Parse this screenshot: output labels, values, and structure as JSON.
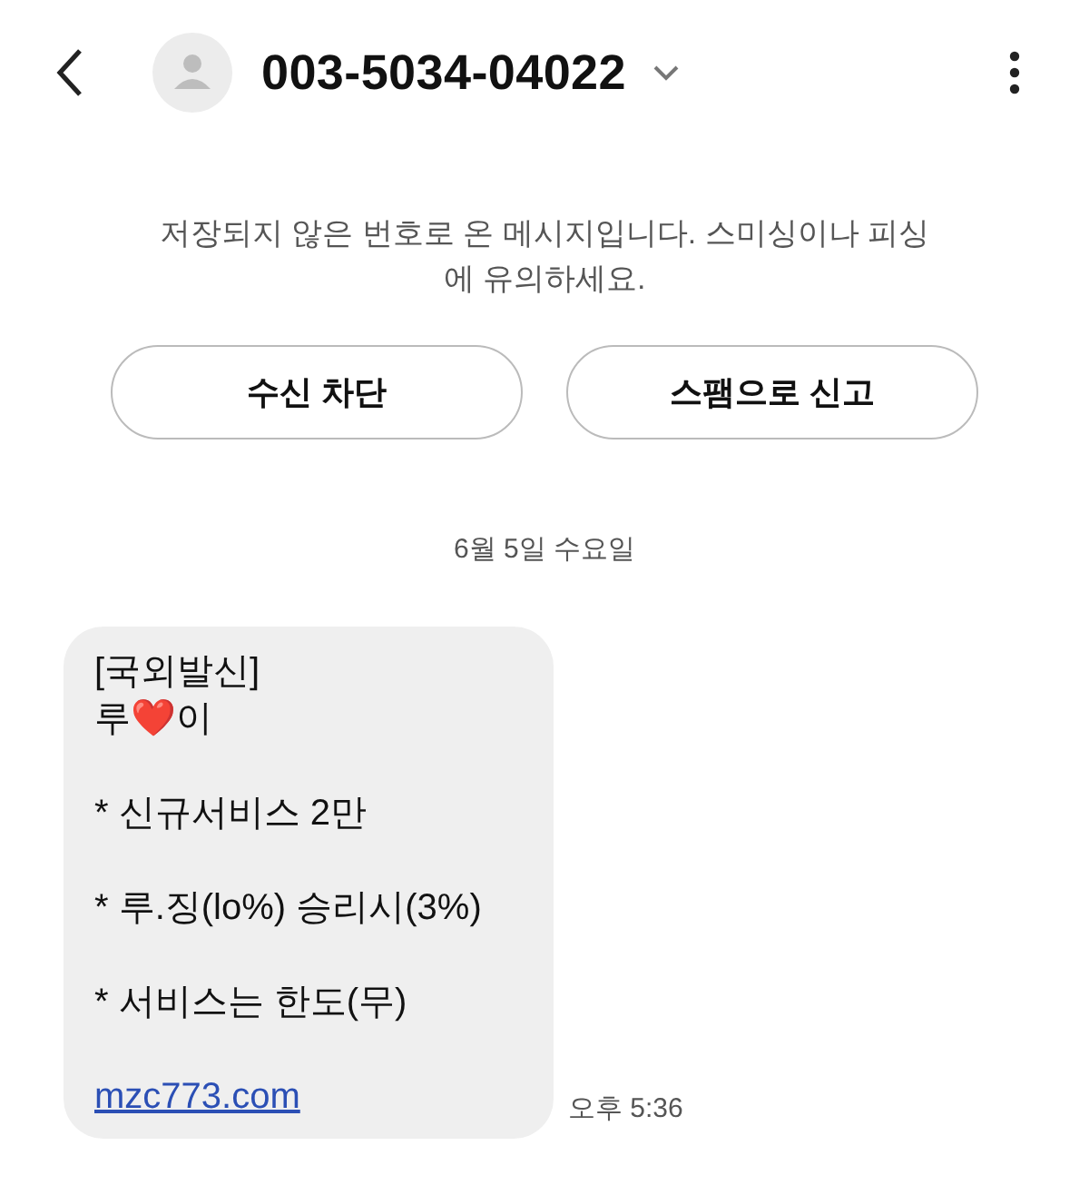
{
  "header": {
    "title": "003-5034-04022"
  },
  "notice": {
    "text": "저장되지 않은 번호로 온 메시지입니다. 스미싱이나 피싱에 유의하세요.",
    "buttons": [
      "수신 차단",
      "스팸으로 신고"
    ]
  },
  "date": "6월 5일 수요일",
  "message": {
    "paragraphs": [
      {
        "kind": "text",
        "lines": [
          "[국외발신]",
          "루❤️이"
        ]
      },
      {
        "kind": "text",
        "lines": [
          "* 신규서비스 2만"
        ]
      },
      {
        "kind": "text",
        "lines": [
          "* 루.징(lo%) 승리시(3%)"
        ]
      },
      {
        "kind": "text",
        "lines": [
          "* 서비스는 한도(무)"
        ]
      },
      {
        "kind": "link",
        "lines": [
          "mzc773.com"
        ]
      }
    ],
    "time": "오후 5:36"
  }
}
